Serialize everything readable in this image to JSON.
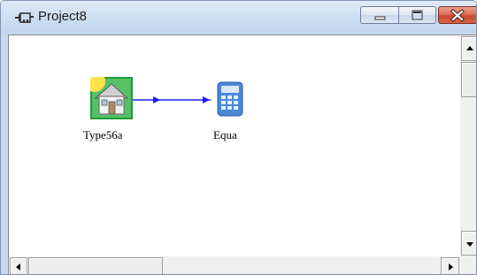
{
  "window": {
    "title": "Project8",
    "title_icon": "plug-icon",
    "caption_buttons": [
      "minimize",
      "maximize",
      "close"
    ]
  },
  "canvas": {
    "components": [
      {
        "label": "Type56a",
        "icon": "house-icon"
      },
      {
        "label": "Equa",
        "icon": "calculator-icon"
      }
    ],
    "connection": {
      "from": "Type56a",
      "to": "Equa",
      "color": "#1a1aff"
    }
  },
  "colors": {
    "titlebar": "#cfdff2",
    "close_button": "#c64a2f",
    "link_line": "#1a1aff"
  }
}
